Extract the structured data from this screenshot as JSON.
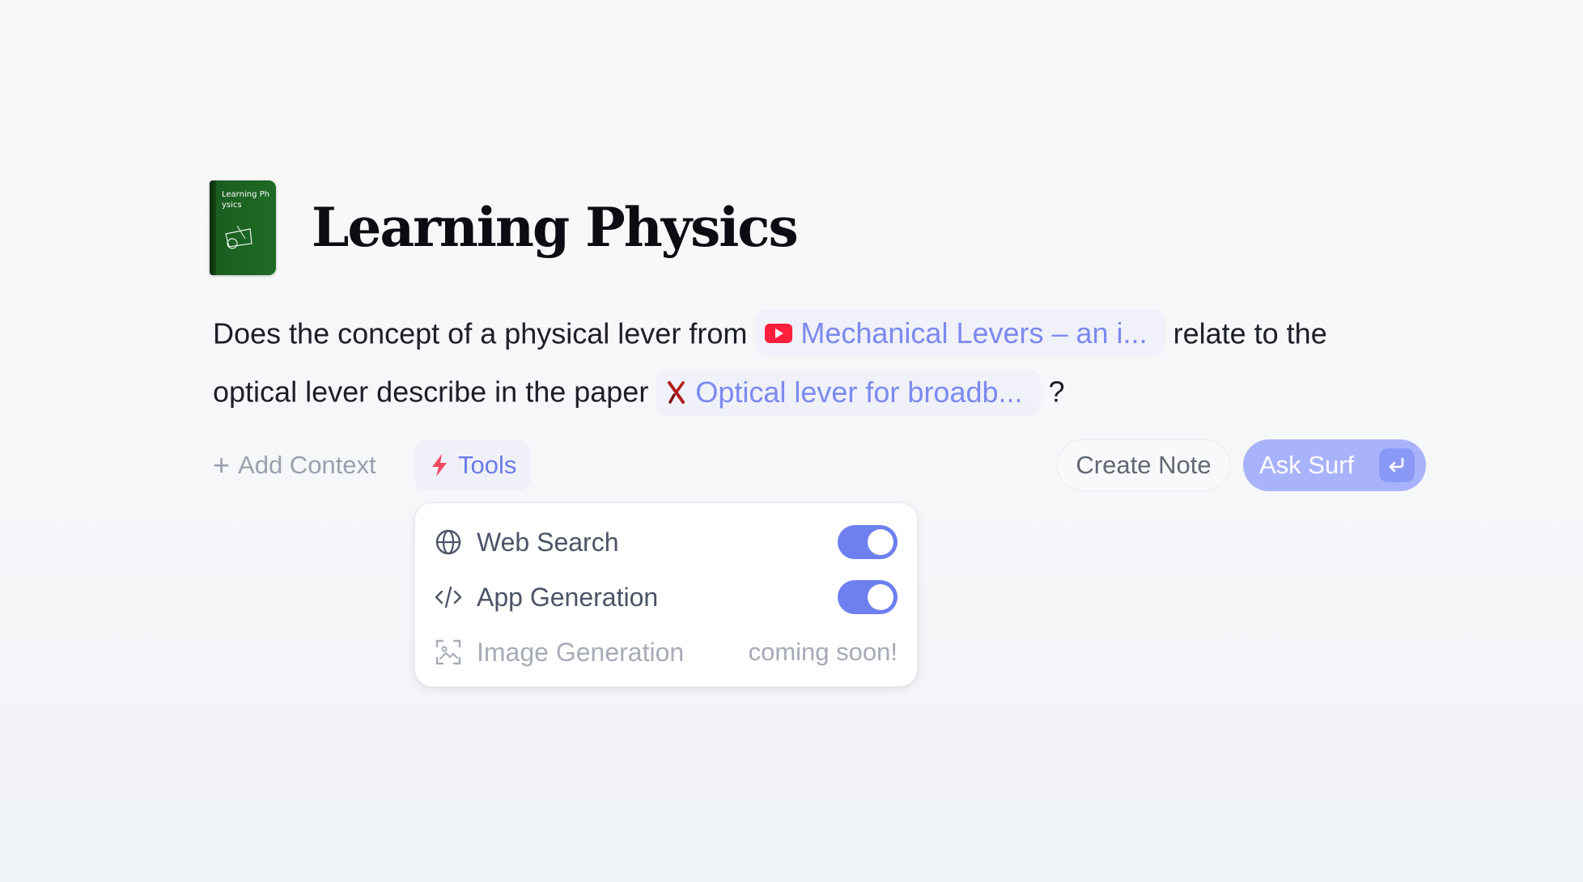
{
  "notebook": {
    "cover_text": "Learning Physics",
    "title": "Learning Physics"
  },
  "prompt": {
    "part1": "Does the concept of a physical lever from",
    "chip1": {
      "label": "Mechanical Levers – an i...",
      "icon": "youtube-icon"
    },
    "part2": "relate to the optical lever describe in the paper",
    "chip2": {
      "label": "Optical lever for broadb...",
      "icon": "arxiv-icon"
    },
    "part3": "?"
  },
  "toolbar": {
    "add_context": "Add Context",
    "tools": "Tools",
    "create_note": "Create Note",
    "ask_surf": "Ask Surf"
  },
  "tools_menu": {
    "items": [
      {
        "label": "Web Search",
        "icon": "globe-icon",
        "enabled": true
      },
      {
        "label": "App Generation",
        "icon": "code-icon",
        "enabled": true
      },
      {
        "label": "Image Generation",
        "icon": "image-scan-icon",
        "status": "coming soon!"
      }
    ]
  },
  "colors": {
    "accent": "#6e7ff0",
    "link": "#7d89ef",
    "ask_button": "#a9b3fb",
    "cover": "#1e6b24",
    "youtube_red": "#ff1f3d",
    "bolt": "#f04b5f"
  }
}
